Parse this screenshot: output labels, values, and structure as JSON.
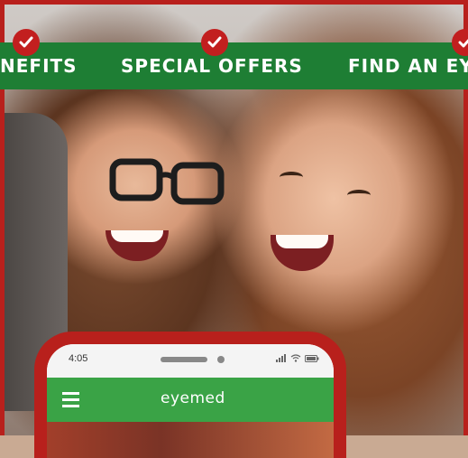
{
  "nav": {
    "items": [
      {
        "label": "NEFITS"
      },
      {
        "label": "SPECIAL OFFERS"
      },
      {
        "label": "FIND AN EY"
      }
    ]
  },
  "phone": {
    "time": "4:05",
    "app_logo": "eyemed",
    "icons": [
      "signal-icon",
      "wifi-icon",
      "battery-icon",
      "hamburger-menu-icon"
    ]
  },
  "colors": {
    "nav_green": "#1e7e34",
    "accent_red": "#c21f1f",
    "app_green": "#3aa346",
    "frame_red": "#b8201c"
  }
}
